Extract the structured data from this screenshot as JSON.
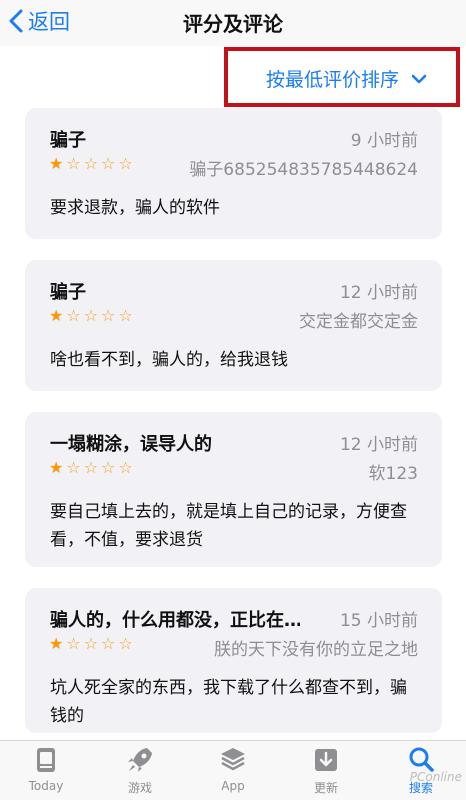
{
  "nav": {
    "back_label": "返回",
    "title": "评分及评论"
  },
  "sort": {
    "label": "按最低评价排序"
  },
  "reviews": [
    {
      "title": "骗子",
      "time": "9 小时前",
      "author": "骗子685254835785448624",
      "rating": 1,
      "body": "要求退款，骗人的软件"
    },
    {
      "title": "骗子",
      "time": "12 小时前",
      "author": "交定金都交定金",
      "rating": 1,
      "body": "啥也看不到，骗人的，给我退钱"
    },
    {
      "title": "一塌糊涂，误导人的",
      "time": "12 小时前",
      "author": "软123",
      "rating": 1,
      "body": "要自己填上去的，就是填上自己的记录，方便查看，不值，要求退货"
    },
    {
      "title": "骗人的，什么用都没，正比在…",
      "time": "15 小时前",
      "author": "朕的天下没有你的立足之地",
      "rating": 1,
      "body": "坑人死全家的东西，我下载了什么都查不到，骗钱的"
    }
  ],
  "tabbar": {
    "today": "Today",
    "games": "游戏",
    "apps": "App",
    "updates": "更新",
    "search": "搜索"
  },
  "watermark": "PConline",
  "colors": {
    "accent": "#1a7cf6",
    "star": "#ff9500",
    "highlight_box": "#c1121c"
  }
}
